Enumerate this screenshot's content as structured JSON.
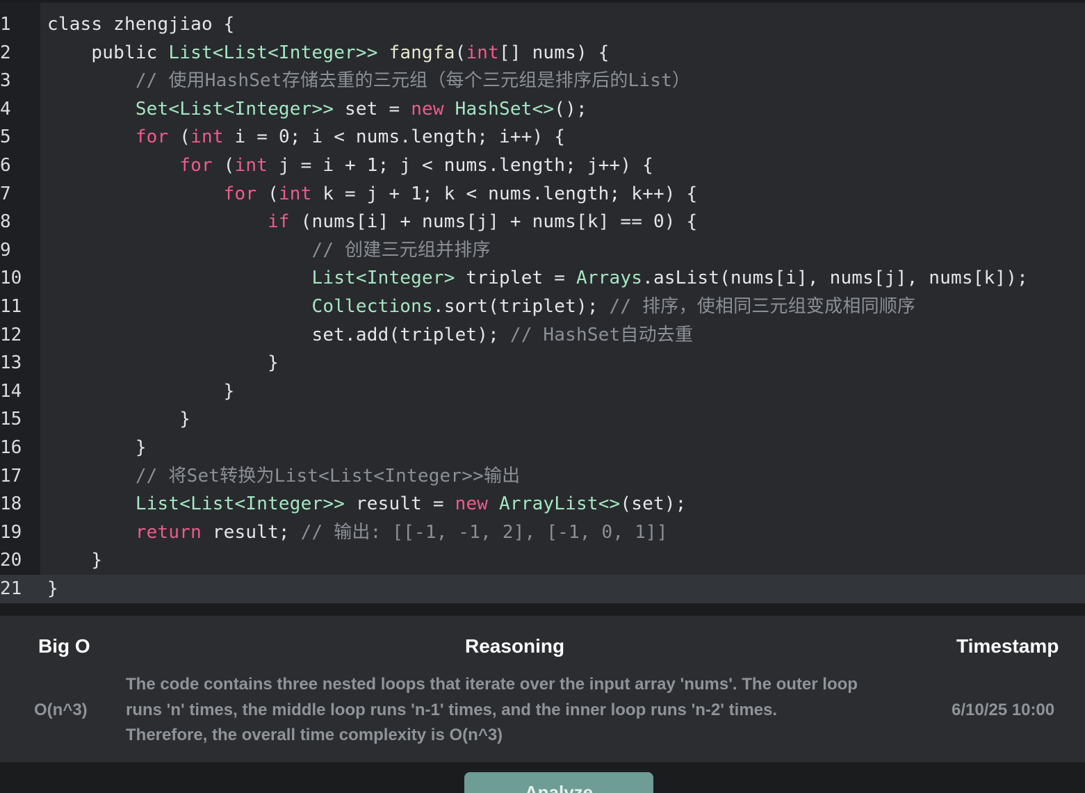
{
  "editor": {
    "current_line": 21,
    "lines": [
      [
        [
          "t",
          "class zhengjiao {"
        ]
      ],
      [
        [
          "t",
          "    public "
        ],
        [
          "ty",
          "List<List<Integer>>"
        ],
        [
          "t",
          " "
        ],
        [
          "fn",
          "fangfa"
        ],
        [
          "t",
          "("
        ],
        [
          "kw",
          "int"
        ],
        [
          "t",
          "[] nums) {"
        ]
      ],
      [
        [
          "cm",
          "        // 使用HashSet存储去重的三元组（每个三元组是排序后的List）"
        ]
      ],
      [
        [
          "t",
          "        "
        ],
        [
          "ty",
          "Set<List<Integer>>"
        ],
        [
          "t",
          " set = "
        ],
        [
          "kw",
          "new"
        ],
        [
          "t",
          " "
        ],
        [
          "ty",
          "HashSet<>"
        ],
        [
          "t",
          "();"
        ]
      ],
      [
        [
          "t",
          "        "
        ],
        [
          "kw",
          "for"
        ],
        [
          "t",
          " ("
        ],
        [
          "kw",
          "int"
        ],
        [
          "t",
          " i = 0; i < nums.length; i++) {"
        ]
      ],
      [
        [
          "t",
          "            "
        ],
        [
          "kw",
          "for"
        ],
        [
          "t",
          " ("
        ],
        [
          "kw",
          "int"
        ],
        [
          "t",
          " j = i + 1; j < nums.length; j++) {"
        ]
      ],
      [
        [
          "t",
          "                "
        ],
        [
          "kw",
          "for"
        ],
        [
          "t",
          " ("
        ],
        [
          "kw",
          "int"
        ],
        [
          "t",
          " k = j + 1; k < nums.length; k++) {"
        ]
      ],
      [
        [
          "t",
          "                    "
        ],
        [
          "kw",
          "if"
        ],
        [
          "t",
          " (nums[i] + nums[j] + nums[k] == 0) {"
        ]
      ],
      [
        [
          "cm",
          "                        // 创建三元组并排序"
        ]
      ],
      [
        [
          "t",
          "                        "
        ],
        [
          "ty",
          "List<Integer>"
        ],
        [
          "t",
          " triplet = "
        ],
        [
          "ty",
          "Arrays"
        ],
        [
          "t",
          ".asList(nums[i], nums[j], nums[k]);"
        ]
      ],
      [
        [
          "t",
          "                        "
        ],
        [
          "ty",
          "Collections"
        ],
        [
          "t",
          ".sort(triplet); "
        ],
        [
          "cm",
          "// 排序，使相同三元组变成相同顺序"
        ]
      ],
      [
        [
          "t",
          "                        set.add(triplet); "
        ],
        [
          "cm",
          "// HashSet自动去重"
        ]
      ],
      [
        [
          "t",
          "                    }"
        ]
      ],
      [
        [
          "t",
          "                }"
        ]
      ],
      [
        [
          "t",
          "            }"
        ]
      ],
      [
        [
          "t",
          "        }"
        ]
      ],
      [
        [
          "cm",
          "        // 将Set转换为List<List<Integer>>输出"
        ]
      ],
      [
        [
          "t",
          "        "
        ],
        [
          "ty",
          "List<List<Integer>>"
        ],
        [
          "t",
          " result = "
        ],
        [
          "kw",
          "new"
        ],
        [
          "t",
          " "
        ],
        [
          "ty",
          "ArrayList<>"
        ],
        [
          "t",
          "(set);"
        ]
      ],
      [
        [
          "t",
          "        "
        ],
        [
          "kw",
          "return"
        ],
        [
          "t",
          " result; "
        ],
        [
          "cm",
          "// 输出: [[-1, -1, 2], [-1, 0, 1]]"
        ]
      ],
      [
        [
          "t",
          "    }"
        ]
      ],
      [
        [
          "t",
          "}"
        ]
      ]
    ]
  },
  "results": {
    "headers": {
      "big_o": "Big O",
      "reasoning": "Reasoning",
      "timestamp": "Timestamp"
    },
    "row": {
      "big_o": "O(n^3)",
      "reasoning_lines": [
        "The code contains three nested loops that iterate over the input array 'nums'. The outer loop",
        "runs 'n' times, the middle loop runs 'n-1' times, and the inner loop runs 'n-2' times.",
        "Therefore, the overall time complexity is O(n^3)"
      ],
      "timestamp": "6/10/25 10:00"
    }
  },
  "actions": {
    "analyze_label": "Analyze"
  },
  "colors": {
    "keyword": "#f05b8a",
    "type": "#a6e7c2",
    "comment": "#8c9097",
    "button": "#6d9d94"
  }
}
